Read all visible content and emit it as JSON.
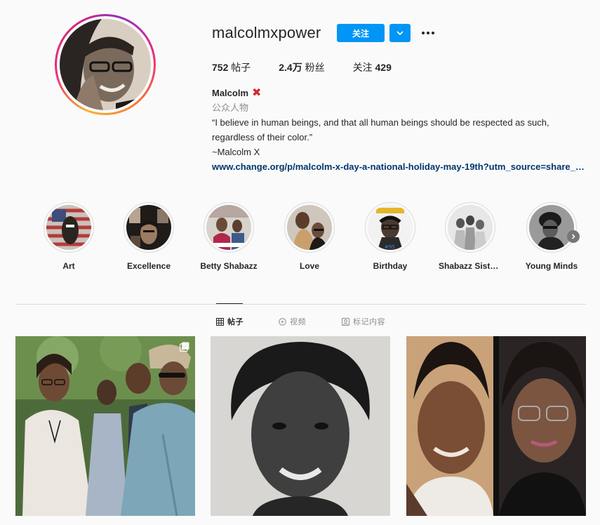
{
  "profile": {
    "username": "malcolmxpower",
    "follow_label": "关注",
    "stats": {
      "posts_value": "752",
      "posts_label": "帖子",
      "followers_value": "2.4万",
      "followers_label": "粉丝",
      "following_label": "关注",
      "following_value": "429"
    },
    "bio": {
      "name": "Malcolm",
      "name_emoji": "✖",
      "category": "公众人物",
      "line1": "“I believe in human beings, and that all human beings should be respected as such,",
      "line2": "regardless of their color.”",
      "line3": "~Malcolm X",
      "link": "www.change.org/p/malcolm-x-day-a-national-holiday-may-19th?utm_source=share_petition&utm_medium=custom_url&recruited_by_id="
    }
  },
  "highlights": [
    {
      "label": "Art"
    },
    {
      "label": "Excellence"
    },
    {
      "label": "Betty Shabazz"
    },
    {
      "label": "Love"
    },
    {
      "label": "Birthday"
    },
    {
      "label": "Shabazz Sisters"
    },
    {
      "label": "Young Minds"
    }
  ],
  "tabs": {
    "posts": "帖子",
    "videos": "视频",
    "tagged": "标记内容"
  },
  "colors": {
    "accent": "#0095f6",
    "link": "#00376b",
    "muted": "#8e8e8e"
  }
}
